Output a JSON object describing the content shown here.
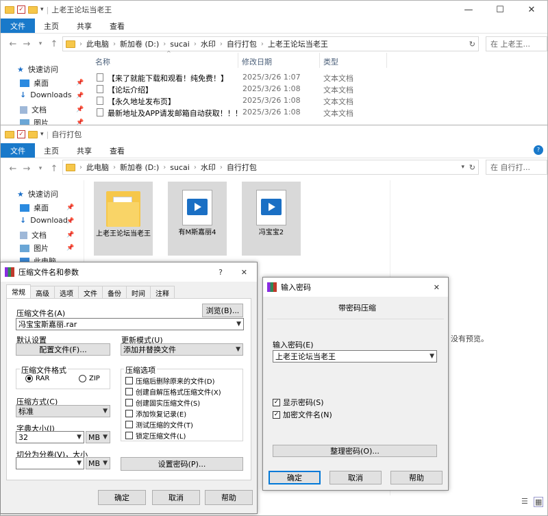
{
  "win1": {
    "title": "上老王论坛当老王",
    "ribbon": {
      "file": "文件",
      "tabs": [
        "主页",
        "共享",
        "查看"
      ]
    },
    "path": [
      "此电脑",
      "新加卷 (D:)",
      "sucai",
      "水印",
      "自行打包",
      "上老王论坛当老王"
    ],
    "search_placeholder": "在 上老王...",
    "nav": [
      {
        "label": "快速访问",
        "icon": "star-icon"
      },
      {
        "label": "桌面",
        "icon": "desktop-icon"
      },
      {
        "label": "Downloads",
        "icon": "download-icon"
      },
      {
        "label": "文档",
        "icon": "document-icon"
      },
      {
        "label": "图片",
        "icon": "picture-icon"
      }
    ],
    "columns": {
      "name": "名称",
      "date": "修改日期",
      "type": "类型"
    },
    "files": [
      {
        "name": "【来了就能下载和观看！纯免费！】",
        "date": "2025/3/26 1:07",
        "type": "文本文档"
      },
      {
        "name": "【论坛介绍】",
        "date": "2025/3/26 1:08",
        "type": "文本文档"
      },
      {
        "name": "【永久地址发布页】",
        "date": "2025/3/26 1:08",
        "type": "文本文档"
      },
      {
        "name": "最新地址及APP请发邮箱自动获取！！！",
        "date": "2025/3/26 1:08",
        "type": "文本文档"
      }
    ]
  },
  "win2": {
    "title": "自行打包",
    "ribbon": {
      "file": "文件",
      "tabs": [
        "主页",
        "共享",
        "查看"
      ]
    },
    "path": [
      "此电脑",
      "新加卷 (D:)",
      "sucai",
      "水印",
      "自行打包"
    ],
    "search_placeholder": "在 自行打...",
    "nav": [
      {
        "label": "快速访问",
        "icon": "star-icon"
      },
      {
        "label": "桌面",
        "icon": "desktop-icon"
      },
      {
        "label": "Download",
        "icon": "download-icon"
      },
      {
        "label": "文档",
        "icon": "document-icon"
      },
      {
        "label": "图片",
        "icon": "picture-icon"
      },
      {
        "label": "此电脑",
        "icon": "pc-icon"
      }
    ],
    "items": [
      {
        "label": "上老王论坛当老王",
        "kind": "folder"
      },
      {
        "label": "有M斯嘉丽4",
        "kind": "video"
      },
      {
        "label": "冯宝宝2",
        "kind": "video"
      }
    ],
    "preview_text": "没有预览。"
  },
  "archive_dialog": {
    "title": "压缩文件名和参数",
    "help": "?",
    "close": "✕",
    "tabs": [
      "常规",
      "高级",
      "选项",
      "文件",
      "备份",
      "时间",
      "注释"
    ],
    "filename_label": "压缩文件名(A)",
    "browse": "浏览(B)...",
    "filename": "冯宝宝斯嘉丽.rar",
    "default_settings": "默认设置",
    "profiles": "配置文件(F)...",
    "update_mode_label": "更新模式(U)",
    "update_mode": "添加并替换文件",
    "format_label": "压缩文件格式",
    "format_rar": "RAR",
    "format_zip": "ZIP",
    "options_label": "压缩选项",
    "options": [
      "压缩后删除原来的文件(D)",
      "创建自解压格式压缩文件(X)",
      "创建固实压缩文件(S)",
      "添加恢复记录(E)",
      "测试压缩的文件(T)",
      "锁定压缩文件(L)"
    ],
    "method_label": "压缩方式(C)",
    "method": "标准",
    "dict_label": "字典大小(I)",
    "dict": "32",
    "dict_unit": "MB",
    "split_label": "切分为分卷(V)，大小",
    "split_unit": "MB",
    "set_password": "设置密码(P)...",
    "ok": "确定",
    "cancel": "取消",
    "help_btn": "帮助"
  },
  "password_dialog": {
    "title": "输入密码",
    "close": "✕",
    "heading": "带密码压缩",
    "input_label": "输入密码(E)",
    "password": "上老王论坛当老王",
    "show_password": "显示密码(S)",
    "encrypt_names": "加密文件名(N)",
    "organize": "整理密码(O)...",
    "ok": "确定",
    "cancel": "取消",
    "help": "帮助"
  }
}
